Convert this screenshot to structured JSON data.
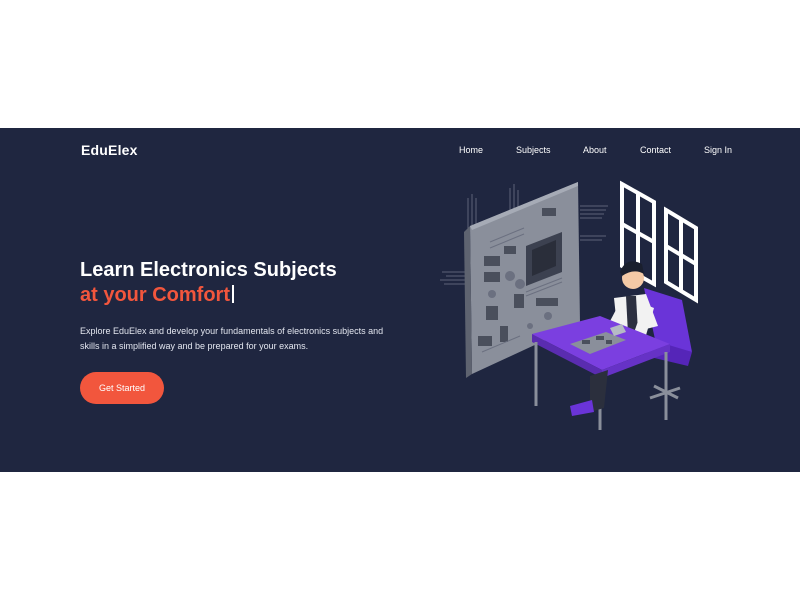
{
  "brand": {
    "name": "EduElex"
  },
  "nav": {
    "items": [
      {
        "label": "Home"
      },
      {
        "label": "Subjects"
      },
      {
        "label": "About"
      },
      {
        "label": "Contact"
      },
      {
        "label": "Sign In"
      }
    ]
  },
  "hero": {
    "headline_line1": "Learn Electronics Subjects",
    "headline_line2": "at your Comfort",
    "description": "Explore EduElex and develop your fundamentals of electronics subjects and skills in a simplified way and be prepared for your exams.",
    "cta_label": "Get Started"
  },
  "colors": {
    "hero_bg": "#1f2640",
    "accent": "#f2563d",
    "text": "#ffffff",
    "illustration_purple": "#7b3fe0"
  },
  "illustration": {
    "icon": "person-working-on-circuit-board-illustration"
  }
}
